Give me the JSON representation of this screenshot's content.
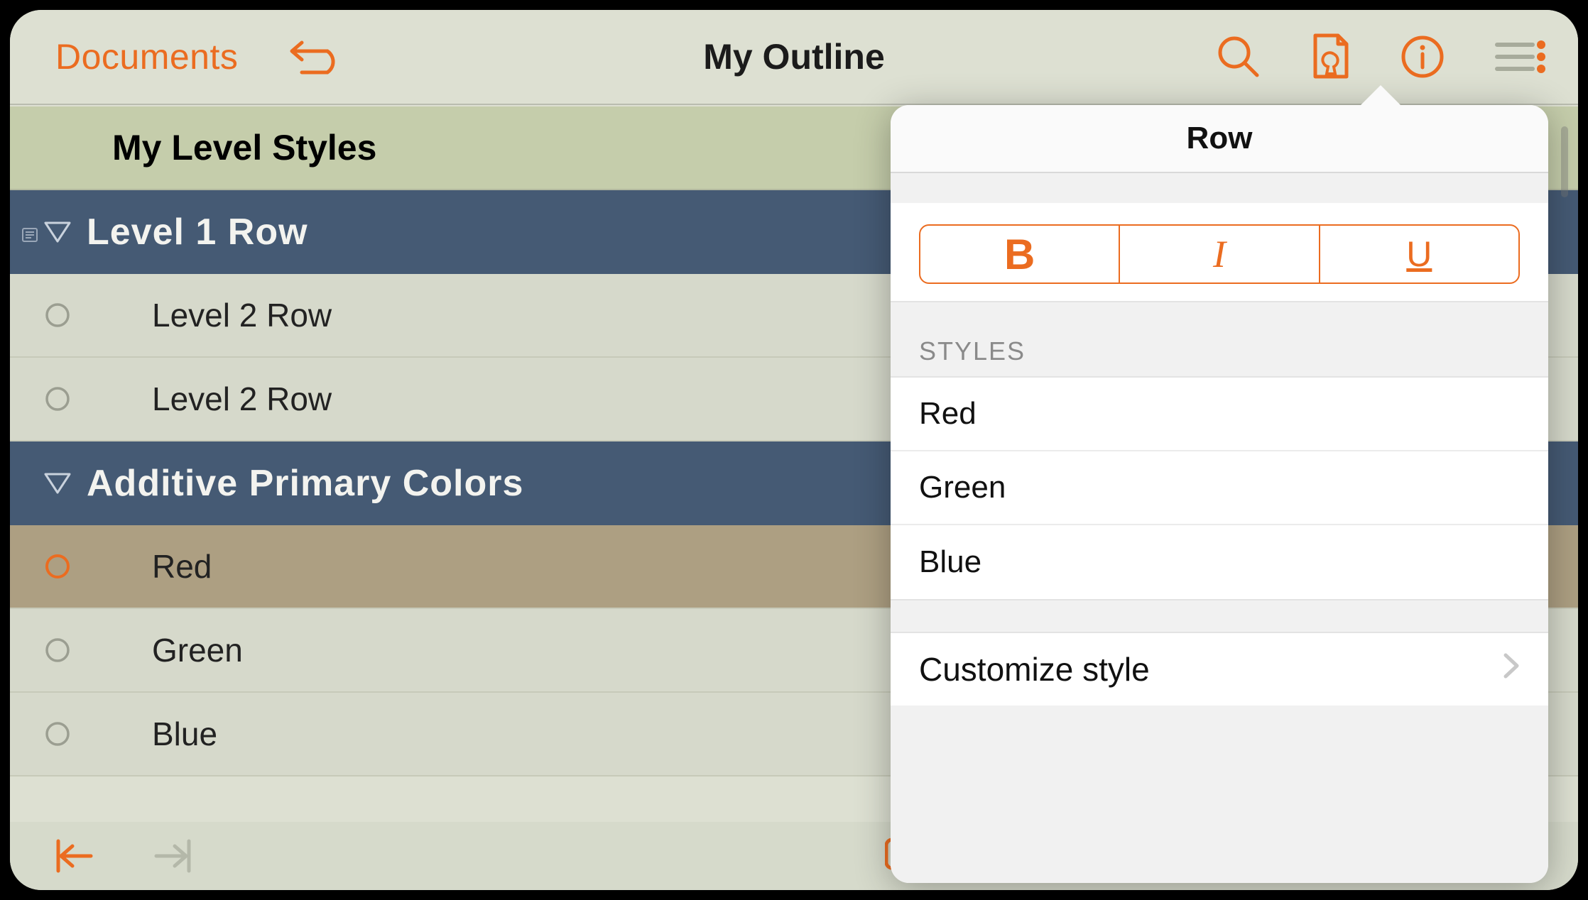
{
  "toolbar": {
    "back_label": "Documents",
    "title": "My Outline"
  },
  "outline": {
    "doc_header": "My Level Styles",
    "rows": [
      {
        "text": "Level 1 Row"
      },
      {
        "text": "Level 2 Row"
      },
      {
        "text": "Level 2 Row"
      },
      {
        "text": "Additive Primary Colors"
      },
      {
        "text": "Red"
      },
      {
        "text": "Green"
      },
      {
        "text": "Blue"
      }
    ]
  },
  "popover": {
    "title": "Row",
    "bold": "B",
    "italic": "I",
    "underline": "U",
    "section_label": "STYLES",
    "styles": [
      "Red",
      "Green",
      "Blue"
    ],
    "customize": "Customize style"
  }
}
